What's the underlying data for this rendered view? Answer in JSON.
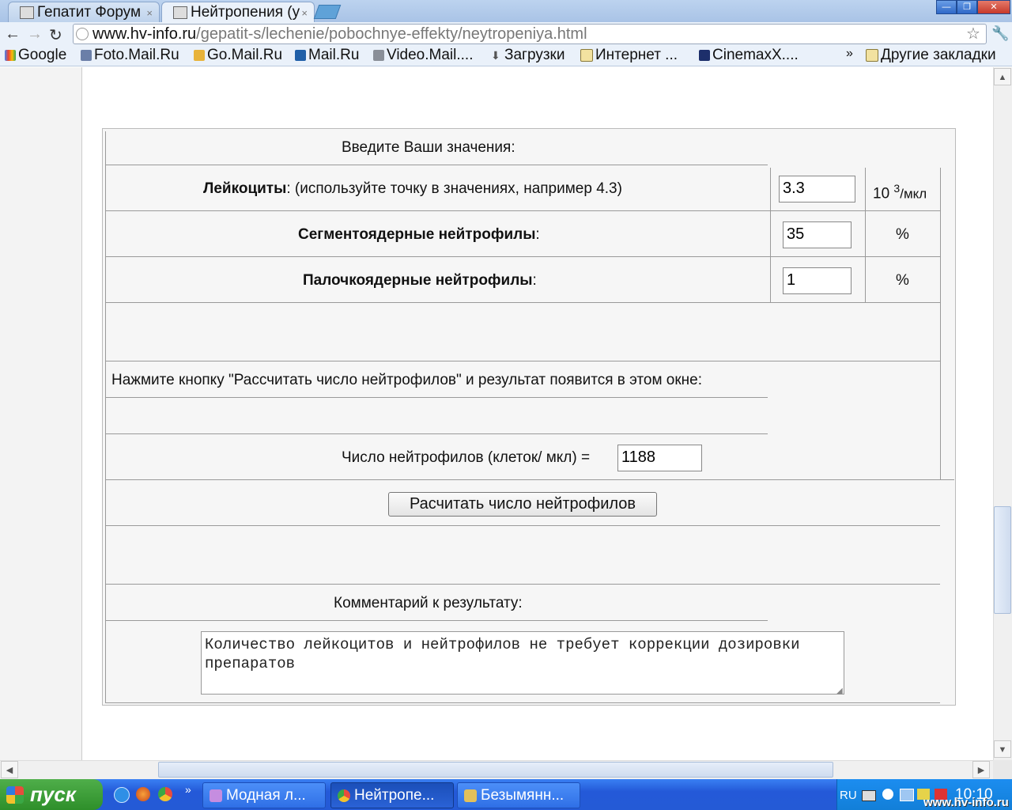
{
  "tabs": [
    {
      "label": "Гепатит Форум",
      "close": "×"
    },
    {
      "label": "Нейтропения (у",
      "close": "×"
    }
  ],
  "address_bar": {
    "host": "www.hv-info.ru",
    "path": "/gepatit-s/lechenie/pobochnye-effekty/neytropeniya.html"
  },
  "bookmarks": [
    {
      "label": "Google"
    },
    {
      "label": "Foto.Mail.Ru"
    },
    {
      "label": "Go.Mail.Ru"
    },
    {
      "label": "Mail.Ru"
    },
    {
      "label": "Video.Mail...."
    },
    {
      "label": "Загрузки"
    },
    {
      "label": "Интернет ..."
    },
    {
      "label": "CinemaxX...."
    }
  ],
  "bookmarks_more": "»",
  "other_bookmarks": "Другие закладки",
  "calculator": {
    "header": "Введите Ваши значения:",
    "leukocytes": {
      "label": "Лейкоциты",
      "hint": ":  (используйте точку в значениях, например 4.3)",
      "value": "3.3",
      "unit_base": "10 ",
      "unit_exp": "3",
      "unit_rest": "/мкл"
    },
    "segmented": {
      "label": "Сегментоядерные нейтрофилы",
      "suffix": ":",
      "value": "35",
      "unit": "%"
    },
    "band": {
      "label": "Палочкоядерные нейтрофилы",
      "suffix": ":",
      "value": "1",
      "unit": "%"
    },
    "instruction": "Нажмите кнопку \"Рассчитать число нейтрофилов\" и результат появится в этом окне:",
    "result_label": "Число нейтрофилов (клеток/ мкл) =",
    "result_value": "1188",
    "button_label": "Расчитать число нейтрофилов",
    "comment_header": "Комментарий к результату:",
    "comment_text": "Количество лейкоцитов и нейтрофилов не требует коррекции дозировки препаратов"
  },
  "taskbar": {
    "start_label": "пуск",
    "quick_more": "»",
    "tasks": [
      {
        "label": "Модная л..."
      },
      {
        "label": "Нейтропе..."
      },
      {
        "label": "Безымянн..."
      }
    ],
    "language": "RU",
    "clock": "10:10",
    "watermark": "www.hv-info.ru"
  },
  "colors": {
    "taskbar_blue": "#245ad6",
    "start_green": "#2e8f2a",
    "chrome_frame": "#bcd3ef"
  }
}
